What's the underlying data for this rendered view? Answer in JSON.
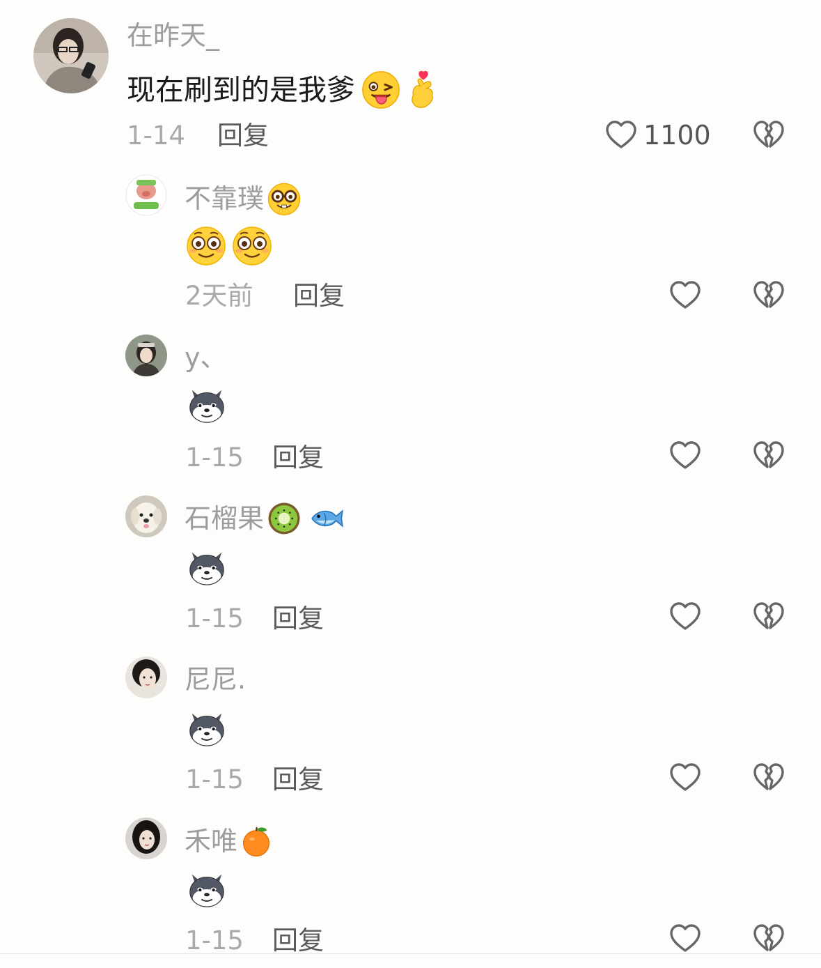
{
  "colors": {
    "background": "#fdfdfb",
    "name_text": "#9c9c9c",
    "content_text": "#1a1a1a",
    "time_text": "#a9a9a9",
    "reply_text": "#5a5a5a",
    "icon_stroke": "#666666"
  },
  "top_comment": {
    "username": "在昨天_",
    "text": "现在刷到的是我爹",
    "emojis": [
      "winking-tongue-emoji",
      "finger-heart-emoji"
    ],
    "time": "1-14",
    "reply_label": "回复",
    "like_count": "1100"
  },
  "replies": [
    {
      "username": "不靠璞",
      "name_emojis": [
        "nerd-face-emoji"
      ],
      "content_emojis": [
        "flushed-smile-emoji",
        "flushed-smile-emoji"
      ],
      "time": "2天前",
      "reply_label": "回复"
    },
    {
      "username": "y、",
      "name_emojis": [],
      "content_emojis": [
        "shiba-dog-emoji"
      ],
      "time": "1-15",
      "reply_label": "回复"
    },
    {
      "username": "石榴果",
      "name_emojis": [
        "kiwi-emoji",
        "fish-emoji"
      ],
      "content_emojis": [
        "shiba-dog-emoji"
      ],
      "time": "1-15",
      "reply_label": "回复"
    },
    {
      "username": "尼尼.",
      "name_emojis": [],
      "content_emojis": [
        "shiba-dog-emoji"
      ],
      "time": "1-15",
      "reply_label": "回复"
    },
    {
      "username": "禾唯",
      "name_emojis": [
        "orange-emoji"
      ],
      "content_emojis": [
        "shiba-dog-emoji"
      ],
      "time": "1-15",
      "reply_label": "回复"
    }
  ]
}
